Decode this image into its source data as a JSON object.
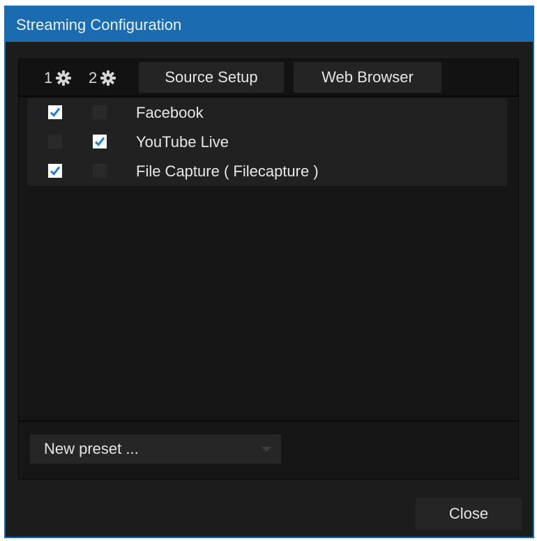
{
  "window": {
    "title": "Streaming Configuration"
  },
  "tabs": {
    "output1_label": "1",
    "output2_label": "2",
    "output1_icon": "gear-icon",
    "output2_icon": "gear-icon",
    "source_setup_label": "Source Setup",
    "web_browser_label": "Web Browser"
  },
  "streams": [
    {
      "label": "Facebook",
      "output1_checked": true,
      "output2_checked": false
    },
    {
      "label": "YouTube Live",
      "output1_checked": false,
      "output2_checked": true
    },
    {
      "label": "File Capture ( Filecapture )",
      "output1_checked": true,
      "output2_checked": false
    }
  ],
  "preset": {
    "value": "New preset ..."
  },
  "buttons": {
    "close_label": "Close"
  },
  "colors": {
    "title_bar": "#1a6bb0",
    "checkbox_checked": "#ffffff",
    "checkmark": "#1f7fd6"
  }
}
